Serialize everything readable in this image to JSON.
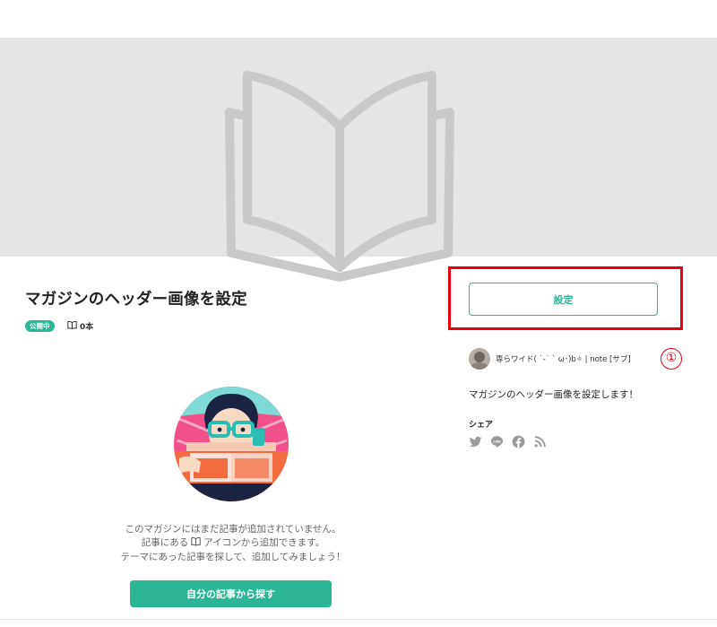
{
  "header_image": {
    "icon": "open-book-icon"
  },
  "magazine": {
    "title": "マガジンのヘッダー画像を設定",
    "status_badge": "公開中",
    "article_count": "0本",
    "description": "マガジンのヘッダー画像を設定します！"
  },
  "empty_state": {
    "line1": "このマガジンにはまだ記事が追加されていません。",
    "line2_before": "記事にある",
    "line2_after": "アイコンから追加できます。",
    "line3": "テーマにあった記事を探して、追加してみましょう！",
    "find_button_label": "自分の記事から探す"
  },
  "sidebar": {
    "settings_button_label": "設定",
    "author_name": "専らワイド( ˙-˙ ` ω･)b✧ | note [サブ]",
    "share_label": "シェア",
    "share_icons": [
      "twitter-icon",
      "line-icon",
      "facebook-icon",
      "rss-icon"
    ]
  },
  "annotation": {
    "marker": "①"
  },
  "colors": {
    "accent": "#2cb696",
    "highlight": "#e60012",
    "header_bg": "#e5e5e5"
  }
}
